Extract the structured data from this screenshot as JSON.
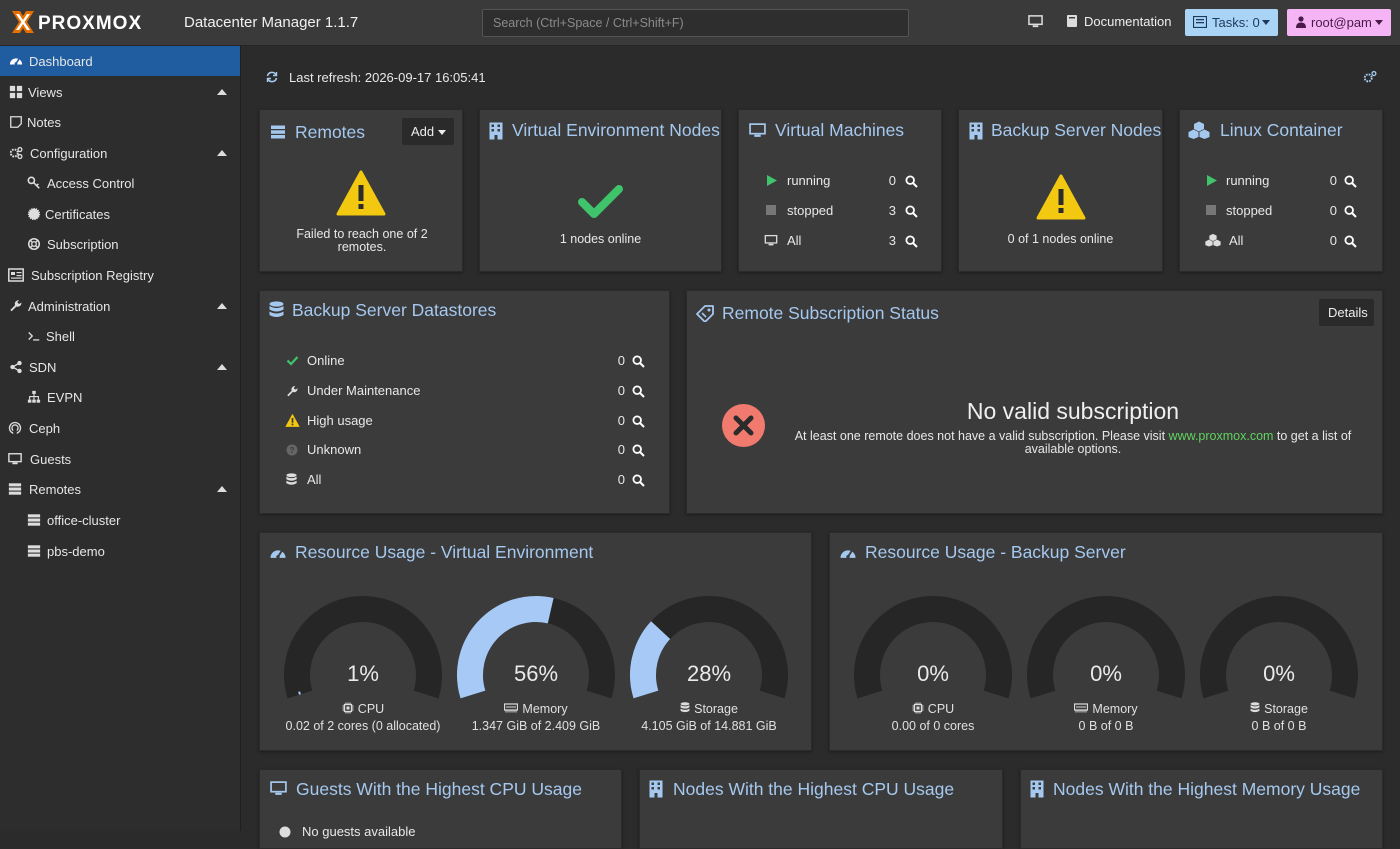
{
  "app": {
    "logo_text": "PROXMOX",
    "title": "Datacenter Manager 1.1.7"
  },
  "topbar": {
    "search_placeholder": "Search (Ctrl+Space / Ctrl+Shift+F)",
    "documentation": "Documentation",
    "tasks": "Tasks: 0",
    "user": "root@pam"
  },
  "sidebar": {
    "items": [
      {
        "label": "Dashboard",
        "icon": "dashboard-icon"
      },
      {
        "label": "Views",
        "icon": "views-icon"
      },
      {
        "label": "Notes",
        "icon": "notes-icon"
      },
      {
        "label": "Configuration",
        "icon": "gears-icon"
      },
      {
        "label": "Access Control",
        "icon": "key-icon"
      },
      {
        "label": "Certificates",
        "icon": "certificate-icon"
      },
      {
        "label": "Subscription",
        "icon": "lifebuoy-icon"
      },
      {
        "label": "Subscription Registry",
        "icon": "registry-icon"
      },
      {
        "label": "Administration",
        "icon": "wrench-icon"
      },
      {
        "label": "Shell",
        "icon": "terminal-icon"
      },
      {
        "label": "SDN",
        "icon": "sdn-icon"
      },
      {
        "label": "EVPN",
        "icon": "sitemap-icon"
      },
      {
        "label": "Ceph",
        "icon": "ceph-icon"
      },
      {
        "label": "Guests",
        "icon": "desktop-icon"
      },
      {
        "label": "Remotes",
        "icon": "server-icon"
      },
      {
        "label": "office-cluster",
        "icon": "server-icon"
      },
      {
        "label": "pbs-demo",
        "icon": "server-icon"
      }
    ]
  },
  "dashboard": {
    "last_refresh": "Last refresh: 2026-09-17 16:05:41",
    "remotes": {
      "title": "Remotes",
      "add": "Add",
      "message": "Failed to reach one of 2 remotes."
    },
    "ve_nodes": {
      "title": "Virtual Environment Nodes",
      "message": "1 nodes online"
    },
    "vms": {
      "title": "Virtual Machines",
      "rows": [
        {
          "label": "running",
          "value": "0"
        },
        {
          "label": "stopped",
          "value": "3"
        },
        {
          "label": "All",
          "value": "3"
        }
      ]
    },
    "pbs_nodes": {
      "title": "Backup Server Nodes",
      "message": "0 of 1 nodes online"
    },
    "lxc": {
      "title": "Linux Container",
      "rows": [
        {
          "label": "running",
          "value": "0"
        },
        {
          "label": "stopped",
          "value": "0"
        },
        {
          "label": "All",
          "value": "0"
        }
      ]
    },
    "datastores": {
      "title": "Backup Server Datastores",
      "rows": [
        {
          "label": "Online",
          "value": "0"
        },
        {
          "label": "Under Maintenance",
          "value": "0"
        },
        {
          "label": "High usage",
          "value": "0"
        },
        {
          "label": "Unknown",
          "value": "0"
        },
        {
          "label": "All",
          "value": "0"
        }
      ]
    },
    "subscription": {
      "title": "Remote Subscription Status",
      "details": "Details",
      "headline": "No valid subscription",
      "text_before": "At least one remote does not have a valid subscription. Please visit ",
      "link": "www.proxmox.com",
      "text_after": " to get a list of available options."
    },
    "res_ve": {
      "title": "Resource Usage - Virtual Environment",
      "gauges": [
        {
          "value": "1%",
          "fraction": 0.01,
          "label": "CPU",
          "detail": "0.02 of 2 cores (0 allocated)"
        },
        {
          "value": "56%",
          "fraction": 0.56,
          "label": "Memory",
          "detail": "1.347 GiB of 2.409 GiB"
        },
        {
          "value": "28%",
          "fraction": 0.28,
          "label": "Storage",
          "detail": "4.105 GiB of 14.881 GiB"
        }
      ]
    },
    "res_pbs": {
      "title": "Resource Usage - Backup Server",
      "gauges": [
        {
          "value": "0%",
          "fraction": 0,
          "label": "CPU",
          "detail": "0.00 of 0 cores"
        },
        {
          "value": "0%",
          "fraction": 0,
          "label": "Memory",
          "detail": "0 B of 0 B"
        },
        {
          "value": "0%",
          "fraction": 0,
          "label": "Storage",
          "detail": "0 B of 0 B"
        }
      ]
    },
    "guests_cpu": {
      "title": "Guests With the Highest CPU Usage",
      "message": "No guests available"
    },
    "nodes_cpu": {
      "title": "Nodes With the Highest CPU Usage"
    },
    "nodes_mem": {
      "title": "Nodes With the Highest Memory Usage"
    }
  },
  "colors": {
    "accent": "#a5c8ef",
    "selected": "#1f5da0",
    "ok": "#3fc46b",
    "warn": "#f2c811",
    "error": "#f07a6e",
    "gauge_fill": "#a6c9f5",
    "gauge_track": "#262626",
    "tasks_bg": "#a9d4f5",
    "user_bg": "#f5b4f4",
    "link": "#5fd35f"
  }
}
